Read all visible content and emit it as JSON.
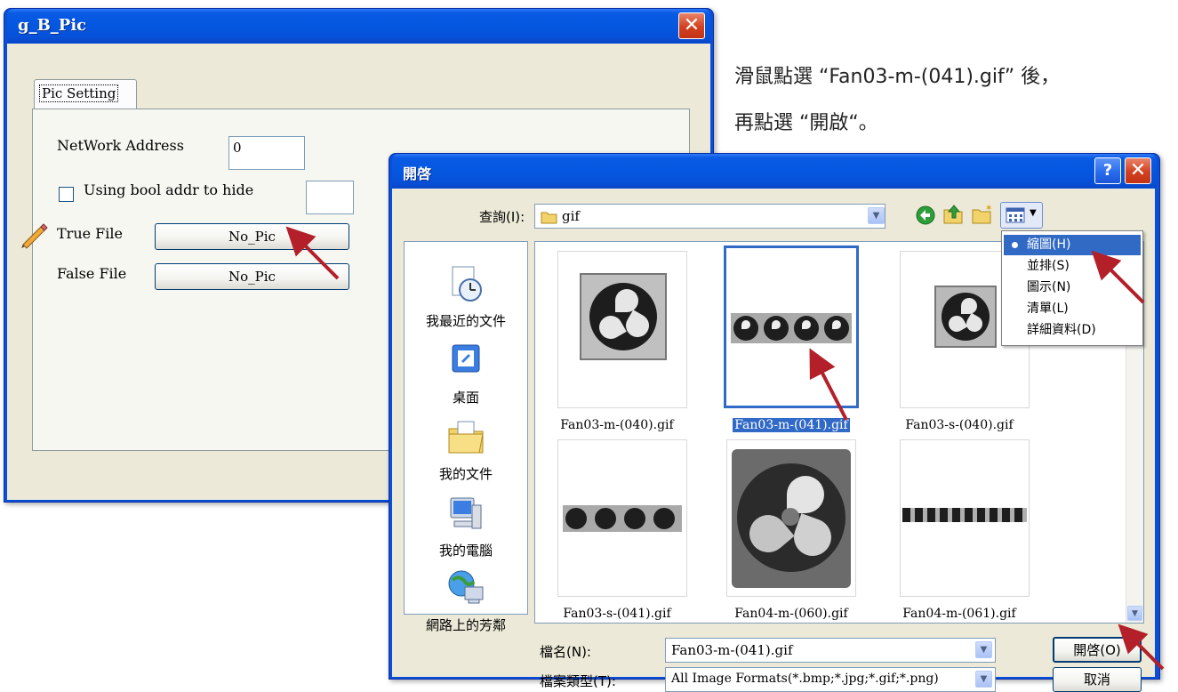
{
  "pic_window": {
    "title": "g_B_Pic",
    "tab_label": "Pic Setting",
    "network_address_label": "NetWork Address",
    "network_address_value": "0",
    "bool_hide_label": "Using bool addr to hide",
    "true_file_label": "True File",
    "true_file_button": "No_Pic",
    "false_file_label": "False File",
    "false_file_button": "No_Pic"
  },
  "instruction": {
    "line1": "滑鼠點選 “Fan03-m-(041).gif” 後，",
    "line2": "再點選 “開啟“。"
  },
  "open_dialog": {
    "title": "開啓",
    "help_glyph": "?",
    "close_glyph": "✕",
    "look_in_label": "查詢(I):",
    "look_in_value": "gif",
    "places": [
      {
        "label": "我最近的文件",
        "icon": "recent-documents-icon"
      },
      {
        "label": "桌面",
        "icon": "desktop-icon"
      },
      {
        "label": "我的文件",
        "icon": "my-documents-icon"
      },
      {
        "label": "我的電腦",
        "icon": "my-computer-icon"
      },
      {
        "label": "網路上的芳鄰",
        "icon": "network-places-icon"
      }
    ],
    "files": [
      {
        "name": "Fan03-m-(040).gif"
      },
      {
        "name": "Fan03-m-(041).gif",
        "selected": true
      },
      {
        "name": "Fan03-s-(040).gif"
      },
      {
        "name": "Fan03-s-(041).gif"
      },
      {
        "name": "Fan04-m-(060).gif"
      },
      {
        "name": "Fan04-m-(061).gif"
      }
    ],
    "view_menu": [
      {
        "label": "縮圖(H)",
        "selected": true
      },
      {
        "label": "並排(S)"
      },
      {
        "label": "圖示(N)"
      },
      {
        "label": "清單(L)"
      },
      {
        "label": "詳細資料(D)"
      }
    ],
    "filename_label": "檔名(N):",
    "filename_value": "Fan03-m-(041).gif",
    "filetype_label": "檔案類型(T):",
    "filetype_value": "All Image Formats(*.bmp;*.jpg;*.gif;*.png)",
    "open_button": "開啓(O)",
    "cancel_button": "取消"
  },
  "colors": {
    "arrow": "#b3202a",
    "selection": "#316ac5",
    "title_bar": "#0a5ae4"
  }
}
